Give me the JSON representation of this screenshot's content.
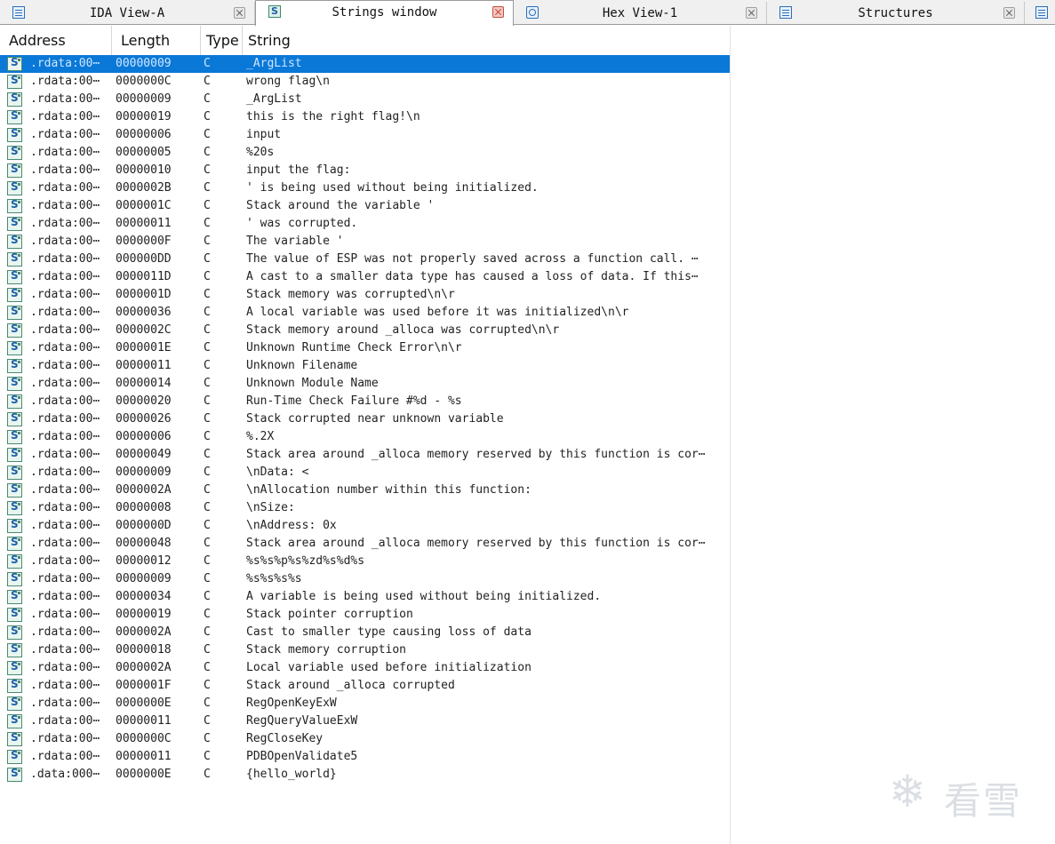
{
  "tabs": [
    {
      "label": "IDA View-A",
      "icon": "disassembly-icon",
      "active": false
    },
    {
      "label": "Strings window",
      "icon": "strings-icon",
      "active": true
    },
    {
      "label": "Hex View-1",
      "icon": "hex-icon",
      "active": false
    },
    {
      "label": "Structures",
      "icon": "structures-icon",
      "active": false
    }
  ],
  "columns": {
    "address": "Address",
    "length": "Length",
    "type": "Type",
    "string": "String"
  },
  "rows": [
    {
      "address": ".rdata:00⋯",
      "length": "00000009",
      "type": "C",
      "string": "_ArgList"
    },
    {
      "address": ".rdata:00⋯",
      "length": "0000000C",
      "type": "C",
      "string": "wrong flag\\n"
    },
    {
      "address": ".rdata:00⋯",
      "length": "00000009",
      "type": "C",
      "string": "_ArgList"
    },
    {
      "address": ".rdata:00⋯",
      "length": "00000019",
      "type": "C",
      "string": "this is the right flag!\\n"
    },
    {
      "address": ".rdata:00⋯",
      "length": "00000006",
      "type": "C",
      "string": "input"
    },
    {
      "address": ".rdata:00⋯",
      "length": "00000005",
      "type": "C",
      "string": "%20s"
    },
    {
      "address": ".rdata:00⋯",
      "length": "00000010",
      "type": "C",
      "string": "input the flag:"
    },
    {
      "address": ".rdata:00⋯",
      "length": "0000002B",
      "type": "C",
      "string": "' is being used without being initialized."
    },
    {
      "address": ".rdata:00⋯",
      "length": "0000001C",
      "type": "C",
      "string": "Stack around the variable '"
    },
    {
      "address": ".rdata:00⋯",
      "length": "00000011",
      "type": "C",
      "string": "' was corrupted."
    },
    {
      "address": ".rdata:00⋯",
      "length": "0000000F",
      "type": "C",
      "string": "The variable '"
    },
    {
      "address": ".rdata:00⋯",
      "length": "000000DD",
      "type": "C",
      "string": "The value of ESP was not properly saved across a function call.  ⋯"
    },
    {
      "address": ".rdata:00⋯",
      "length": "0000011D",
      "type": "C",
      "string": "A cast to a smaller data type has caused a loss of data.  If this⋯"
    },
    {
      "address": ".rdata:00⋯",
      "length": "0000001D",
      "type": "C",
      "string": "Stack memory was corrupted\\n\\r"
    },
    {
      "address": ".rdata:00⋯",
      "length": "00000036",
      "type": "C",
      "string": "A local variable was used before it was initialized\\n\\r"
    },
    {
      "address": ".rdata:00⋯",
      "length": "0000002C",
      "type": "C",
      "string": "Stack memory around _alloca was corrupted\\n\\r"
    },
    {
      "address": ".rdata:00⋯",
      "length": "0000001E",
      "type": "C",
      "string": "Unknown Runtime Check Error\\n\\r"
    },
    {
      "address": ".rdata:00⋯",
      "length": "00000011",
      "type": "C",
      "string": "Unknown Filename"
    },
    {
      "address": ".rdata:00⋯",
      "length": "00000014",
      "type": "C",
      "string": "Unknown Module Name"
    },
    {
      "address": ".rdata:00⋯",
      "length": "00000020",
      "type": "C",
      "string": "Run-Time Check Failure #%d - %s"
    },
    {
      "address": ".rdata:00⋯",
      "length": "00000026",
      "type": "C",
      "string": "Stack corrupted near unknown variable"
    },
    {
      "address": ".rdata:00⋯",
      "length": "00000006",
      "type": "C",
      "string": "%.2X"
    },
    {
      "address": ".rdata:00⋯",
      "length": "00000049",
      "type": "C",
      "string": "Stack area around _alloca memory reserved by this function is cor⋯"
    },
    {
      "address": ".rdata:00⋯",
      "length": "00000009",
      "type": "C",
      "string": "\\nData: <"
    },
    {
      "address": ".rdata:00⋯",
      "length": "0000002A",
      "type": "C",
      "string": "\\nAllocation number within this function:"
    },
    {
      "address": ".rdata:00⋯",
      "length": "00000008",
      "type": "C",
      "string": "\\nSize:"
    },
    {
      "address": ".rdata:00⋯",
      "length": "0000000D",
      "type": "C",
      "string": "\\nAddress: 0x"
    },
    {
      "address": ".rdata:00⋯",
      "length": "00000048",
      "type": "C",
      "string": "Stack area around _alloca memory reserved by this function is cor⋯"
    },
    {
      "address": ".rdata:00⋯",
      "length": "00000012",
      "type": "C",
      "string": "%s%s%p%s%zd%s%d%s"
    },
    {
      "address": ".rdata:00⋯",
      "length": "00000009",
      "type": "C",
      "string": "%s%s%s%s"
    },
    {
      "address": ".rdata:00⋯",
      "length": "00000034",
      "type": "C",
      "string": "A variable is being used without being initialized."
    },
    {
      "address": ".rdata:00⋯",
      "length": "00000019",
      "type": "C",
      "string": "Stack pointer corruption"
    },
    {
      "address": ".rdata:00⋯",
      "length": "0000002A",
      "type": "C",
      "string": "Cast to smaller type causing loss of data"
    },
    {
      "address": ".rdata:00⋯",
      "length": "00000018",
      "type": "C",
      "string": "Stack memory corruption"
    },
    {
      "address": ".rdata:00⋯",
      "length": "0000002A",
      "type": "C",
      "string": "Local variable used before initialization"
    },
    {
      "address": ".rdata:00⋯",
      "length": "0000001F",
      "type": "C",
      "string": "Stack around _alloca corrupted"
    },
    {
      "address": ".rdata:00⋯",
      "length": "0000000E",
      "type": "C",
      "string": "RegOpenKeyExW"
    },
    {
      "address": ".rdata:00⋯",
      "length": "00000011",
      "type": "C",
      "string": "RegQueryValueExW"
    },
    {
      "address": ".rdata:00⋯",
      "length": "0000000C",
      "type": "C",
      "string": "RegCloseKey"
    },
    {
      "address": ".rdata:00⋯",
      "length": "00000011",
      "type": "C",
      "string": "PDBOpenValidate5"
    },
    {
      "address": ".data:000⋯",
      "length": "0000000E",
      "type": "C",
      "string": "{hello_world}"
    }
  ],
  "selected_row": 0,
  "watermark": {
    "text": "看雪",
    "icon": "snowflake-icon"
  },
  "colors": {
    "selection": "#0a78d7",
    "tab_close_active": "#c0392b"
  }
}
